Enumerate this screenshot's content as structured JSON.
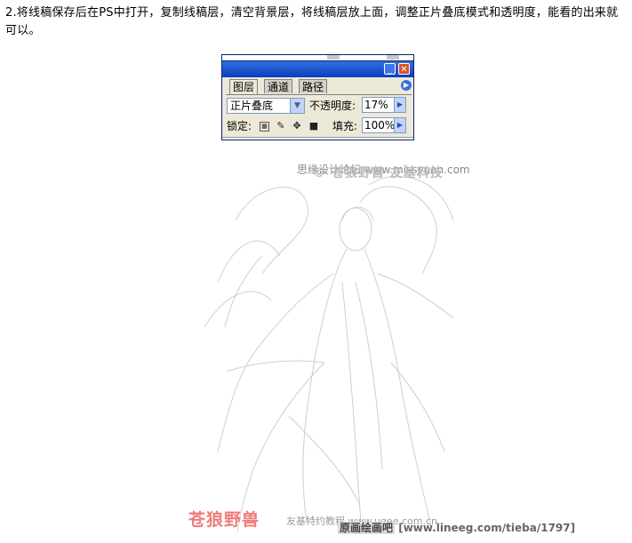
{
  "caption": "2.将线稿保存后在PS中打开，复制线稿层，清空背景层，将线稿层放上面，调整正片叠底模式和透明度，能看的出来就可以。",
  "layers_panel": {
    "tabs": [
      "图层",
      "通道",
      "路径"
    ],
    "active_tab": "图层",
    "blend_mode": "正片叠底",
    "opacity_label": "不透明度:",
    "opacity_value": "17%",
    "lock_label": "锁定:",
    "fill_label": "填充:",
    "fill_value": "100%",
    "titlebar_color": "#0a3fbf",
    "icons": [
      "minimize-icon",
      "close-icon",
      "panel-menu-arrow-icon",
      "lock-transparent-icon",
      "lock-paint-icon",
      "lock-move-icon",
      "lock-all-icon"
    ]
  },
  "watermarks": {
    "top_small": "思缘设计论坛 www.missyuan.com",
    "top_large": "© 苍狼野兽  友基科技",
    "logo": "苍狼野兽",
    "bottom_text": "友基特约教程 www.ugee.com.cn",
    "bottom_box": "原画绘画吧",
    "bottom_url": "[www.lineeg.com/tieba/1797]"
  }
}
